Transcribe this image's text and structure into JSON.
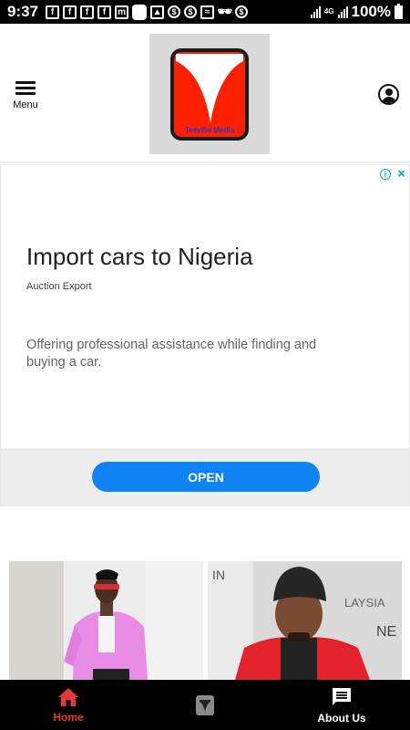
{
  "status_bar": {
    "time": "9:37",
    "left_icons": [
      "facebook-icon",
      "facebook-icon",
      "facebook-icon",
      "facebook-icon",
      "messenger-icon",
      "app-icon",
      "image-icon",
      "dollar-icon",
      "dollar-icon",
      "wifi-icon",
      "incognito-icon",
      "dollar-icon"
    ],
    "network": "4G",
    "battery": "100%"
  },
  "header": {
    "menu_label": "Menu",
    "logo_text": "Teevibe Media",
    "logo_colors": {
      "primary": "#ff2000",
      "border": "#1a1a1a",
      "text": "#1b3bd8"
    }
  },
  "ad": {
    "title": "Import cars to Nigeria",
    "advertiser": "Auction Export",
    "description": "Offering professional assistance while finding and buying a car.",
    "cta": "OPEN",
    "cta_color": "#0e84f4",
    "info_icon": "info-icon",
    "close_icon": "close-icon"
  },
  "articles": [
    {
      "image": "article-image-man-pink-jacket"
    },
    {
      "image": "article-image-man-beanie-red-jacket"
    }
  ],
  "bottom_nav": {
    "items": [
      {
        "label": "Home",
        "icon": "home-icon",
        "active": true
      },
      {
        "label": "",
        "icon": "logo-icon",
        "active": false
      },
      {
        "label": "About Us",
        "icon": "chat-icon",
        "active": false
      }
    ],
    "active_color": "#e53935"
  }
}
